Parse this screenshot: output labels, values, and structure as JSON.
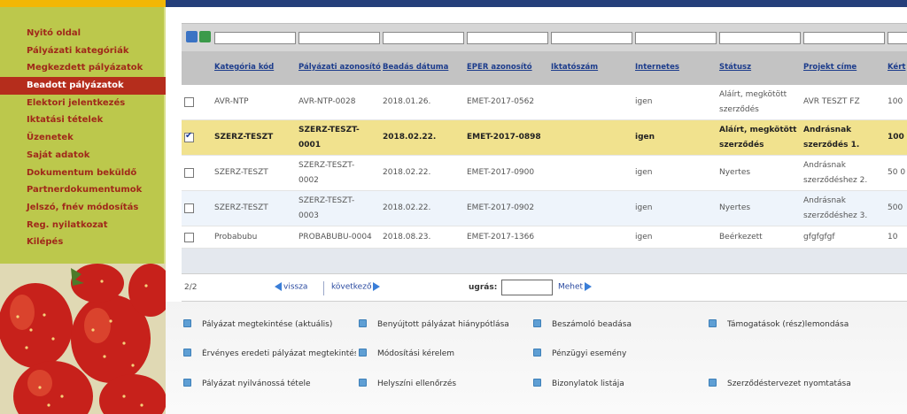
{
  "sidebar": {
    "items": [
      {
        "label": "Nyitó oldal"
      },
      {
        "label": "Pályázati kategóriák"
      },
      {
        "label": "Megkezdett pályázatok"
      },
      {
        "label": "Beadott pályázatok"
      },
      {
        "label": "Elektori jelentkezés"
      },
      {
        "label": "Iktatási tételek"
      },
      {
        "label": "Üzenetek"
      },
      {
        "label": "Saját adatok"
      },
      {
        "label": "Dokumentum beküldő"
      },
      {
        "label": "Partnerdokumentumok"
      },
      {
        "label": "Jelszó, fnév módosítás"
      },
      {
        "label": "Reg. nyilatkozat"
      },
      {
        "label": "Kilépés"
      }
    ],
    "active_item": "Beadott pályázatok"
  },
  "table": {
    "columns": [
      "Kategória kód",
      "Pályázati azonosító",
      "Beadás dátuma",
      "EPER azonosító",
      "Iktatószám",
      "Internetes",
      "Státusz",
      "Projekt címe",
      "Kért"
    ],
    "rows": [
      {
        "kat": "AVR-NTP",
        "azon": "AVR-NTP-0028",
        "datum": "2018.01.26.",
        "eper": "EMET-2017-0562",
        "ikt": "",
        "internetes": "igen",
        "status": "Aláírt, megkötött szerződés",
        "projekt": "AVR TESZT FZ",
        "kert": "100",
        "checked": false
      },
      {
        "kat": "SZERZ-TESZT",
        "azon": "SZERZ-TESZT-0001",
        "datum": "2018.02.22.",
        "eper": "EMET-2017-0898",
        "ikt": "",
        "internetes": "igen",
        "status": "Aláírt, megkötött szerződés",
        "projekt": "Andrásnak szerződés 1.",
        "kert": "100",
        "checked": true
      },
      {
        "kat": "SZERZ-TESZT",
        "azon": "SZERZ-TESZT-0002",
        "datum": "2018.02.22.",
        "eper": "EMET-2017-0900",
        "ikt": "",
        "internetes": "igen",
        "status": "Nyertes",
        "projekt": "Andrásnak szerződéshez 2.",
        "kert": "50 0",
        "checked": false
      },
      {
        "kat": "SZERZ-TESZT",
        "azon": "SZERZ-TESZT-0003",
        "datum": "2018.02.22.",
        "eper": "EMET-2017-0902",
        "ikt": "",
        "internetes": "igen",
        "status": "Nyertes",
        "projekt": "Andrásnak szerződéshez 3.",
        "kert": "500",
        "checked": false
      },
      {
        "kat": "Probabubu",
        "azon": "PROBABUBU-0004",
        "datum": "2018.08.23.",
        "eper": "EMET-2017-1366",
        "ikt": "",
        "internetes": "igen",
        "status": "Beérkezett",
        "projekt": "gfgfgfgf",
        "kert": "10",
        "checked": false
      }
    ]
  },
  "pager": {
    "page_info": "2/2",
    "back_label": "vissza",
    "next_label": "következő",
    "jump_label": "ugrás:",
    "jump_value": "",
    "go_label": "Mehet"
  },
  "actions": [
    "Pályázat megtekintése (aktuális)",
    "Benyújtott pályázat hiánypótlása",
    "Beszámoló beadása",
    "Támogatások (rész)lemondása",
    "Érvényes eredeti pályázat megtekintése",
    "Módosítási kérelem",
    "Pénzügyi esemény",
    "Pályázat nyilvánossá tétele",
    "Helyszíni ellenőrzés",
    "Bizonylatok listája",
    "Szerződéstervezet nyomtatása"
  ],
  "colors": {
    "sidebar_bg": "#b9c54a",
    "menu_text": "#a0291a",
    "active_bg": "#b52d1c",
    "topbar": "#253f7a",
    "selected_row": "#f1e28e",
    "link": "#1c3c8c"
  },
  "icons": [
    "refresh-icon",
    "excel-export-icon",
    "checkmark-icon",
    "arrow-left-icon",
    "arrow-right-icon",
    "go-arrow-icon",
    "bullet-icon",
    "strawberry-image"
  ]
}
